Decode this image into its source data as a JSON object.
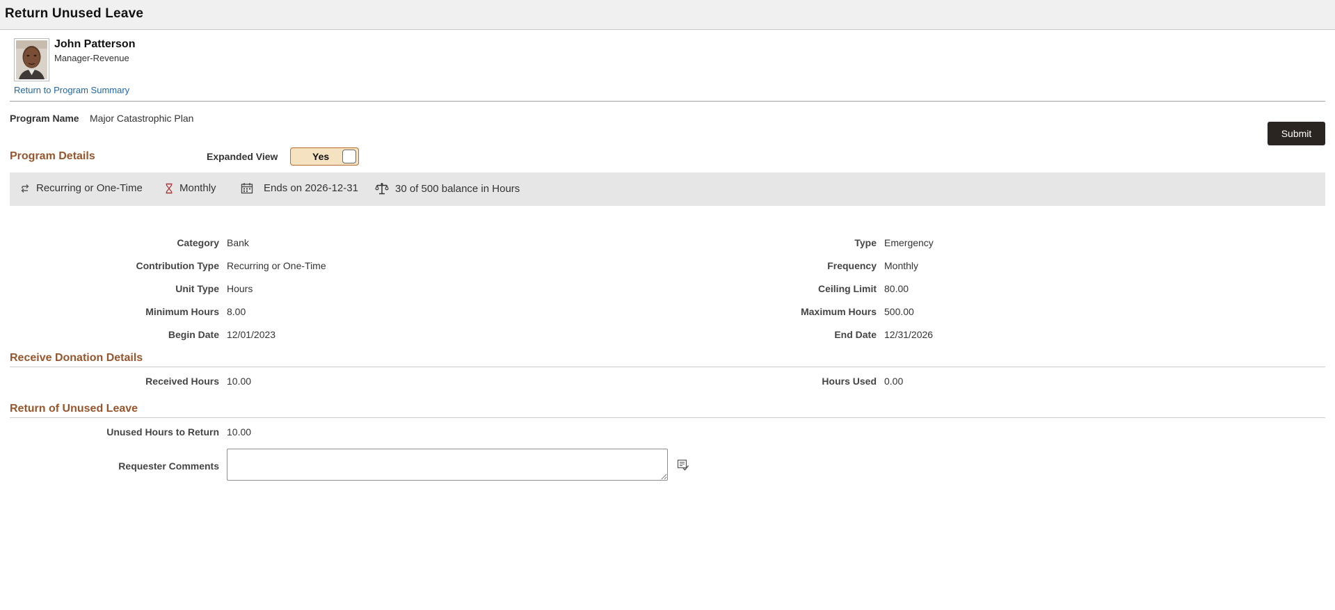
{
  "header": {
    "title": "Return Unused Leave"
  },
  "employee": {
    "name": "John Patterson",
    "job_title": "Manager-Revenue",
    "return_link": "Return to Program Summary"
  },
  "program": {
    "name_label": "Program Name",
    "name_value": "Major Catastrophic Plan"
  },
  "actions": {
    "submit_label": "Submit"
  },
  "program_details": {
    "section_title": "Program Details",
    "expanded_view_label": "Expanded View",
    "expanded_view_value": "Yes",
    "summary": {
      "contribution": "Recurring or One-Time",
      "frequency": "Monthly",
      "ends_on": "Ends on 2026-12-31",
      "balance": "30 of 500 balance in Hours"
    },
    "fields": {
      "category_label": "Category",
      "category_value": "Bank",
      "type_label": "Type",
      "type_value": "Emergency",
      "contribution_type_label": "Contribution Type",
      "contribution_type_value": "Recurring or One-Time",
      "frequency_label": "Frequency",
      "frequency_value": "Monthly",
      "unit_type_label": "Unit Type",
      "unit_type_value": "Hours",
      "ceiling_limit_label": "Ceiling Limit",
      "ceiling_limit_value": "80.00",
      "min_hours_label": "Minimum Hours",
      "min_hours_value": "8.00",
      "max_hours_label": "Maximum Hours",
      "max_hours_value": "500.00",
      "begin_date_label": "Begin Date",
      "begin_date_value": "12/01/2023",
      "end_date_label": "End Date",
      "end_date_value": "12/31/2026"
    }
  },
  "receive_donation": {
    "section_title": "Receive Donation Details",
    "received_hours_label": "Received Hours",
    "received_hours_value": "10.00",
    "hours_used_label": "Hours Used",
    "hours_used_value": "0.00"
  },
  "return_unused": {
    "section_title": "Return of Unused Leave",
    "unused_hours_label": "Unused Hours to Return",
    "unused_hours_value": "10.00",
    "comments_label": "Requester Comments",
    "comments_value": ""
  },
  "icons": {
    "contribution": "recurring-arrows-icon",
    "frequency": "hourglass-icon",
    "ends_on": "calendar-icon",
    "balance": "scales-icon",
    "comments": "spell-check-icon"
  },
  "colors": {
    "section_accent": "#98552b",
    "link": "#2067a8",
    "submit_bg": "#2b2522",
    "toggle_bg": "#f5e2c1",
    "summary_bg": "#e6e6e6"
  }
}
